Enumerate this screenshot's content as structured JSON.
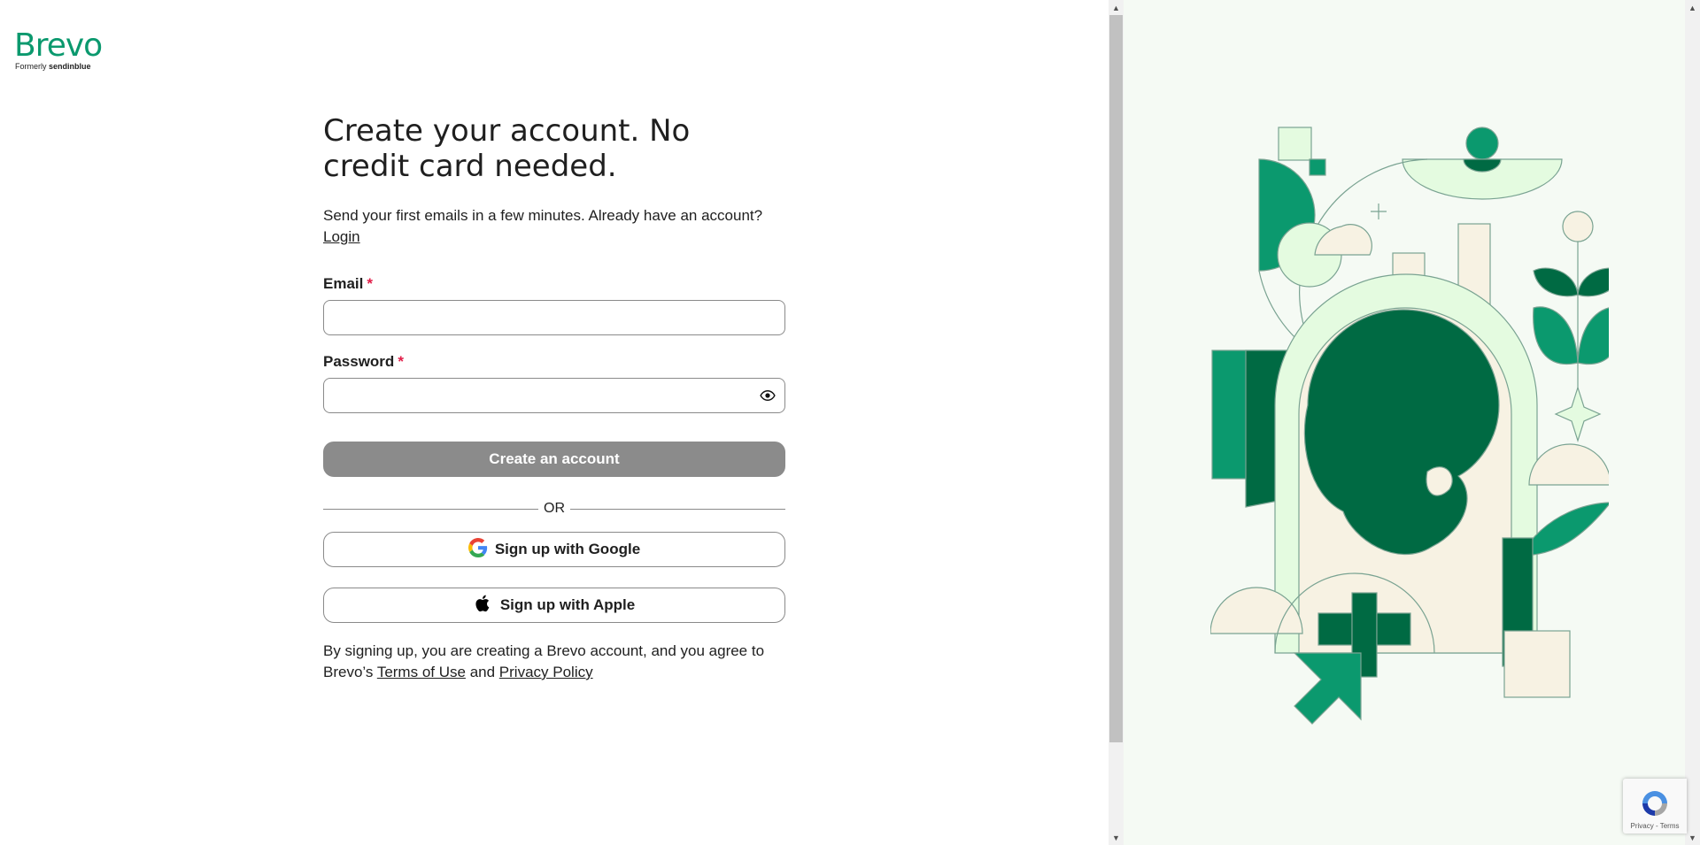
{
  "brand": {
    "name": "Brevo",
    "formerly_prefix": "Formerly",
    "formerly_name": "sendinblue"
  },
  "form": {
    "title": "Create your account. No credit card needed.",
    "subtitle": "Send your first emails in a few minutes. Already have an account?",
    "login_link": "Login",
    "email_label": "Email",
    "password_label": "Password",
    "required_mark": "*",
    "email_value": "",
    "password_value": "",
    "create_button": "Create an account",
    "or_text": "OR",
    "google_button": "Sign up with Google",
    "apple_button": "Sign up with Apple",
    "legal_prefix": "By signing up, you are creating a Brevo account, and you agree to Brevo’s",
    "terms_link": "Terms of Use",
    "legal_and": "and",
    "privacy_link": "Privacy Policy"
  },
  "recaptcha": {
    "links": "Privacy - Terms"
  },
  "colors": {
    "brand_green": "#0b996e",
    "dark_green": "#006a43",
    "pale_green": "#e4fbe0",
    "cream": "#f7f2e3",
    "right_bg": "#f5faf4",
    "disabled_button": "#8b8b8b",
    "required": "#e11d48"
  },
  "icons": {
    "eye": "eye-icon",
    "google": "google-icon",
    "apple": "apple-icon"
  }
}
